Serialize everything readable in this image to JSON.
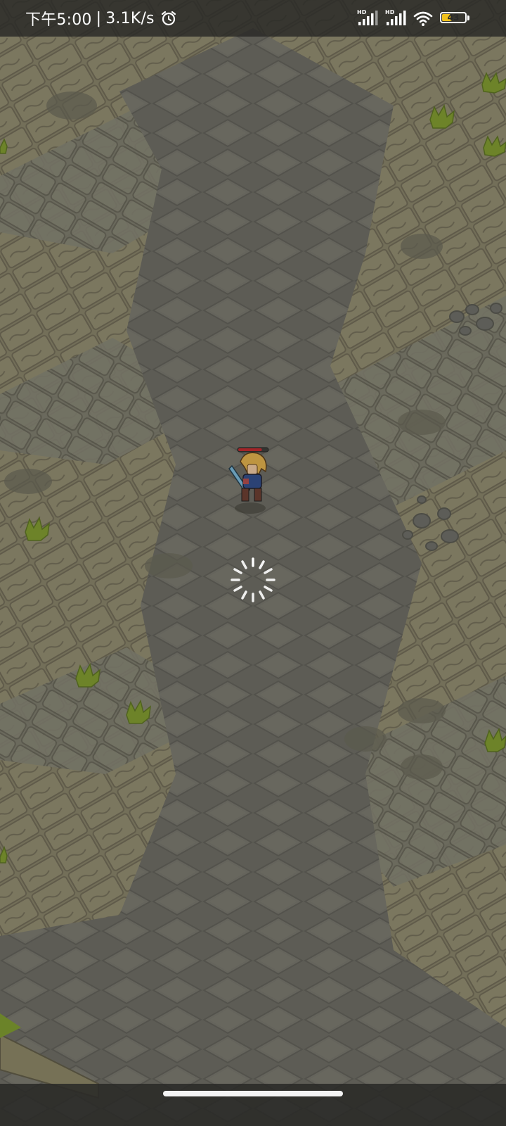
{
  "status_bar": {
    "time": "下午5:00",
    "separator": "|",
    "network_speed": "3.1K/s",
    "alarm_icon": "alarm-clock-icon",
    "signal_1_label": "HD",
    "signal_2_label": "HD",
    "wifi_icon": "wifi-icon",
    "battery_level": "43",
    "battery_percent": 43,
    "text_color": "#ffffff",
    "battery_color": "#f2c21b"
  },
  "game": {
    "player": {
      "icon": "swordsman-character-icon",
      "health_fraction": 0.8,
      "health_color": "#c0262b"
    },
    "loading_indicator": "spinner-icon"
  },
  "colors": {
    "stone_dark": "#6f6f66",
    "stone_light": "#8a876d",
    "grass": "#7e9a2c"
  }
}
